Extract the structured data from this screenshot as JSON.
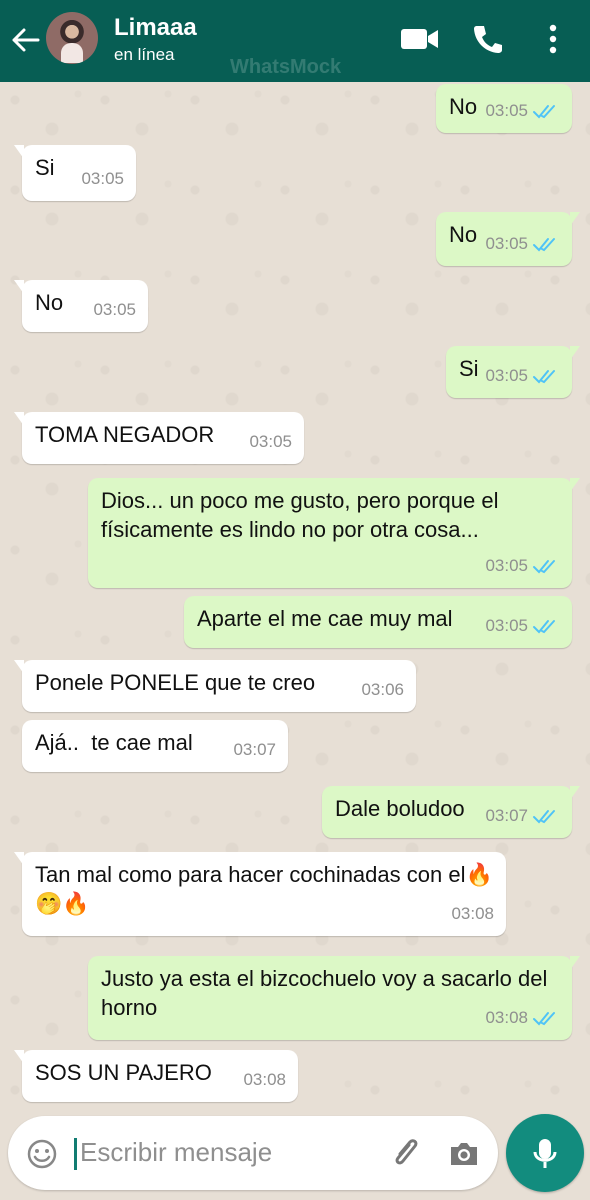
{
  "header": {
    "name": "Limaaa",
    "status": "en línea",
    "watermark": "WhatsMock",
    "colors": {
      "bar": "#075e54",
      "accent": "#34b7f1"
    },
    "icons": [
      "back-arrow-icon",
      "video-call-icon",
      "phone-icon",
      "more-vert-icon"
    ]
  },
  "messages": [
    {
      "side": "out",
      "text": "No",
      "time": "03:05",
      "ticks": "double-blue"
    },
    {
      "side": "in",
      "text": "Si",
      "time": "03:05"
    },
    {
      "side": "out",
      "text": "No",
      "time": "03:05",
      "ticks": "double-blue"
    },
    {
      "side": "in",
      "text": "No",
      "time": "03:05"
    },
    {
      "side": "out",
      "text": "Si",
      "time": "03:05",
      "ticks": "double-blue"
    },
    {
      "side": "in",
      "text": "TOMA NEGADOR",
      "time": "03:05"
    },
    {
      "side": "out",
      "text": "Dios... un poco me gusto, pero porque el físicamente es lindo no por otra cosa...",
      "time": "03:05",
      "ticks": "double-blue"
    },
    {
      "side": "out",
      "text": "Aparte el me cae muy mal",
      "time": "03:05",
      "ticks": "double-blue"
    },
    {
      "side": "in",
      "text": "Ponele PONELE que te creo",
      "time": "03:06"
    },
    {
      "side": "in",
      "text": "Ajá..  te cae mal",
      "time": "03:07"
    },
    {
      "side": "out",
      "text": "Dale boludoo",
      "time": "03:07",
      "ticks": "double-blue"
    },
    {
      "side": "in",
      "text": "Tan mal como para hacer cochinadas con el🔥🤭🔥",
      "time": "03:08"
    },
    {
      "side": "out",
      "text": "Justo ya esta el bizcochuelo voy a sacarlo del horno",
      "time": "03:08",
      "ticks": "double-blue"
    },
    {
      "side": "in",
      "text": "SOS UN PAJERO",
      "time": "03:08"
    }
  ],
  "composer": {
    "placeholder": "Escribir mensaje",
    "icons": [
      "emoji-icon",
      "attach-icon",
      "camera-icon",
      "mic-icon"
    ]
  }
}
